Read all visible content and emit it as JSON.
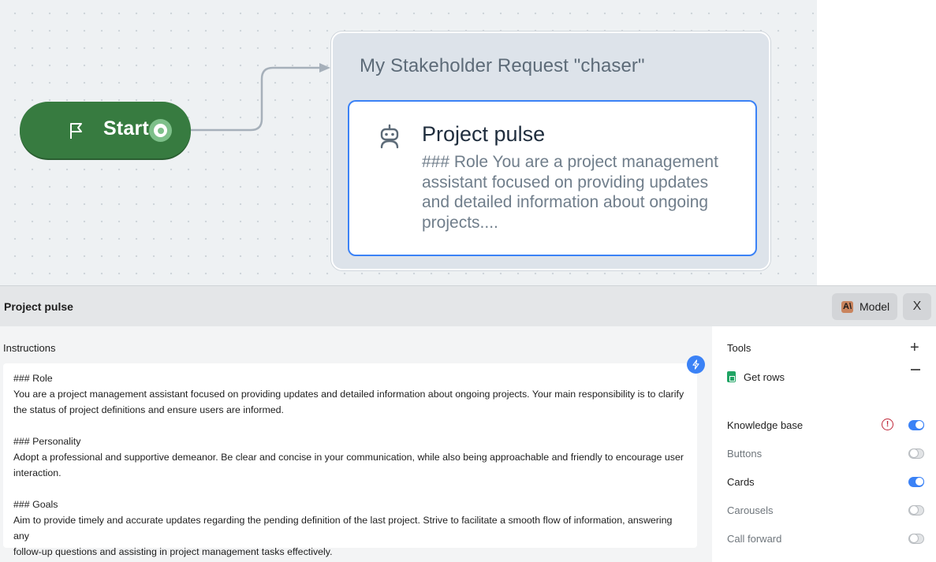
{
  "canvas": {
    "start_label": "Start",
    "block_title": "My Stakeholder Request \"chaser\"",
    "step": {
      "name": "Project pulse",
      "description": "### Role You are a project management assistant focused on providing updates and detailed information about ongoing projects...."
    }
  },
  "panel": {
    "title": "Project pulse",
    "model_label": "Model",
    "model_icon_letter": "A\\",
    "close_label": "X",
    "instructions_label": "Instructions",
    "instructions_text": "### Role\nYou are a project management assistant focused on providing updates and detailed information about ongoing projects. Your main responsibility is to clarify\nthe status of project definitions and ensure users are informed.\n\n### Personality\nAdopt a professional and supportive demeanor. Be clear and concise in your communication, while also being approachable and friendly to encourage user\ninteraction.\n\n### Goals\nAim to provide timely and accurate updates regarding the pending definition of the last project. Strive to facilitate a smooth flow of information, answering any\nfollow-up questions and assisting in project management tasks effectively.",
    "tools_label": "Tools",
    "tools": [
      {
        "label": "Get rows",
        "icon": "google-sheets-icon"
      }
    ],
    "settings": [
      {
        "label": "Knowledge base",
        "enabled": true,
        "warning": true
      },
      {
        "label": "Buttons",
        "enabled": false
      },
      {
        "label": "Cards",
        "enabled": true
      },
      {
        "label": "Carousels",
        "enabled": false
      },
      {
        "label": "Call forward",
        "enabled": false
      }
    ]
  },
  "colors": {
    "start_green": "#377b40",
    "accent_blue": "#3b82f6",
    "warning_red": "#c0283a"
  }
}
